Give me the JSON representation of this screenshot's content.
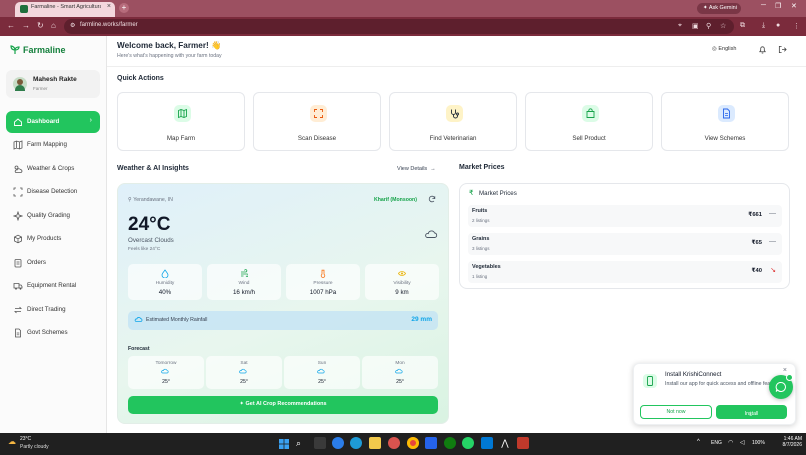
{
  "browser": {
    "tab_title": "Farmaline - Smart Agricultural P",
    "url": "farmline.works/farmer",
    "ask_gemini": "Ask Gemini"
  },
  "sidebar": {
    "brand": "Farmaline",
    "user_name": "Mahesh Rakte",
    "user_role": "Farmer",
    "items": [
      {
        "label": "Dashboard",
        "icon": "home-icon",
        "active": true
      },
      {
        "label": "Farm Mapping",
        "icon": "map-icon"
      },
      {
        "label": "Weather & Crops",
        "icon": "cloud-sun-icon"
      },
      {
        "label": "Disease Detection",
        "icon": "scan-icon"
      },
      {
        "label": "Quality Grading",
        "icon": "sparkle-icon"
      },
      {
        "label": "My Products",
        "icon": "package-icon"
      },
      {
        "label": "Orders",
        "icon": "clipboard-icon"
      },
      {
        "label": "Equipment Rental",
        "icon": "truck-icon"
      },
      {
        "label": "Direct Trading",
        "icon": "swap-icon"
      },
      {
        "label": "Govt Schemes",
        "icon": "document-icon"
      }
    ]
  },
  "header": {
    "welcome": "Welcome back, Farmer! 👋",
    "subtitle": "Here's what's happening with your farm today",
    "language": "English"
  },
  "quick_actions": {
    "title": "Quick Actions",
    "items": [
      {
        "label": "Map Farm",
        "icon": "map-icon",
        "color": "#dcfce7"
      },
      {
        "label": "Scan Disease",
        "icon": "scan-icon",
        "color": "#ffedd5"
      },
      {
        "label": "Find Veterinarian",
        "icon": "stethoscope-icon",
        "color": "#fef3c7"
      },
      {
        "label": "Sell Product",
        "icon": "shopping-bag-icon",
        "color": "#dcfce7"
      },
      {
        "label": "View Schemes",
        "icon": "file-text-icon",
        "color": "#dbeafe"
      }
    ]
  },
  "weather": {
    "title": "Weather & AI Insights",
    "view_details": "View Details",
    "location": "Yerandawane, IN",
    "season": "Kharif (Monsoon)",
    "temperature": "24°C",
    "condition": "Overcast Clouds",
    "feels_like": "Feels like 24°C",
    "stats": [
      {
        "label": "Humidity",
        "value": "40%",
        "icon": "droplet-icon"
      },
      {
        "label": "Wind",
        "value": "16 km/h",
        "icon": "wind-icon"
      },
      {
        "label": "Pressure",
        "value": "1007 hPa",
        "icon": "thermometer-icon"
      },
      {
        "label": "Visibility",
        "value": "9 km",
        "icon": "eye-icon"
      }
    ],
    "rainfall_label": "Estimated Monthly Rainfall",
    "rainfall_value": "29 mm",
    "forecast_title": "Forecast",
    "forecast": [
      {
        "day": "Tomorrow",
        "temp": "25°"
      },
      {
        "day": "Sat",
        "temp": "25°"
      },
      {
        "day": "Sun",
        "temp": "25°"
      },
      {
        "day": "Mon",
        "temp": "25°"
      }
    ],
    "ai_button": "Get AI Crop Recommendations"
  },
  "market": {
    "title": "Market Prices",
    "card_title": "Market Prices",
    "rows": [
      {
        "name": "Fruits",
        "listings": "2 listings",
        "price": "₹661",
        "trend": "—"
      },
      {
        "name": "Grains",
        "listings": "3 listings",
        "price": "₹65",
        "trend": "—"
      },
      {
        "name": "Vegetables",
        "listings": "1 listing",
        "price": "₹40",
        "trend": "↘"
      }
    ]
  },
  "install": {
    "title": "Install KrishiConnect",
    "description": "Install our app for quick access and offline features",
    "not_now": "Not now",
    "install": "Install"
  },
  "taskbar": {
    "weather_temp": "23°C",
    "weather_cond": "Partly cloudy",
    "lang": "ENG",
    "battery": "100%",
    "time": "1:46 AM",
    "date": "8/7/2026"
  }
}
